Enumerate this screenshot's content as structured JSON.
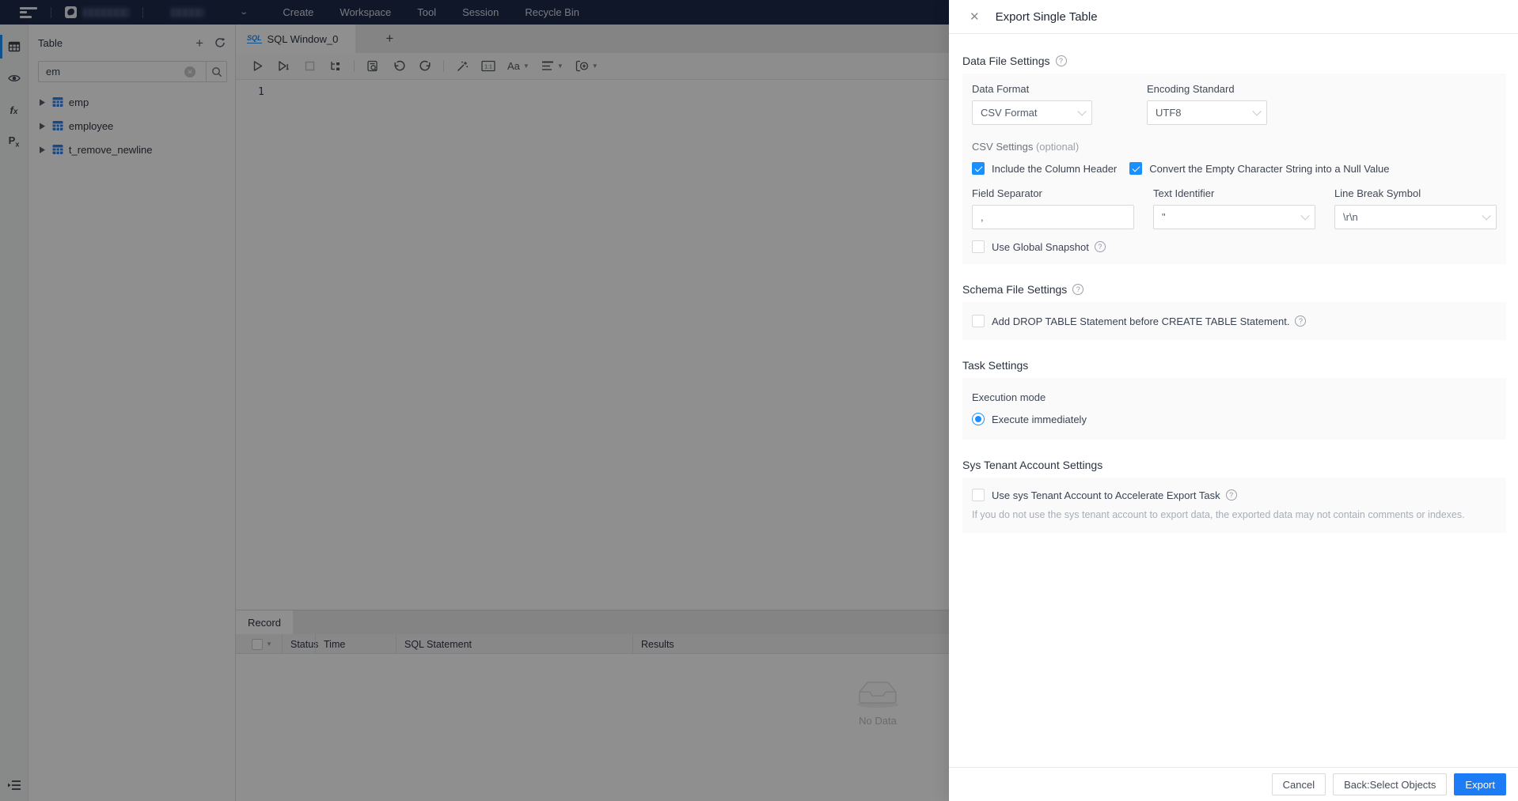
{
  "topbar": {
    "menu": [
      "Create",
      "Workspace",
      "Tool",
      "Session",
      "Recycle Bin"
    ]
  },
  "sidebar": {
    "title": "Table",
    "search_value": "em",
    "tree": [
      {
        "label": "emp"
      },
      {
        "label": "employee"
      },
      {
        "label": "t_remove_newline"
      }
    ]
  },
  "workbench": {
    "tab_badge": "SQL",
    "tab_label": "SQL Window_0",
    "new_tab": "+",
    "editor_line_number": "1",
    "toolbar": {
      "aa_label": "Aa",
      "ratio_label": "1:1"
    }
  },
  "record": {
    "tab": "Record",
    "columns": [
      "Status",
      "Time",
      "SQL Statement",
      "Results"
    ],
    "empty_text": "No Data"
  },
  "drawer": {
    "title": "Export Single Table",
    "data_file": {
      "heading": "Data File Settings",
      "data_format_label": "Data Format",
      "data_format_value": "CSV Format",
      "encoding_label": "Encoding Standard",
      "encoding_value": "UTF8",
      "csv_heading": "CSV Settings",
      "csv_optional": "(optional)",
      "cb_include_header": "Include the Column Header",
      "cb_empty_to_null": "Convert the Empty Character String into a Null Value",
      "field_separator_label": "Field Separator",
      "field_separator_value": ",",
      "text_identifier_label": "Text Identifier",
      "text_identifier_value": "\"",
      "line_break_label": "Line Break Symbol",
      "line_break_value": "\\r\\n",
      "cb_global_snapshot": "Use Global Snapshot"
    },
    "schema": {
      "heading": "Schema File Settings",
      "cb_drop_table": "Add DROP TABLE Statement before CREATE TABLE Statement."
    },
    "task": {
      "heading": "Task Settings",
      "execution_mode_label": "Execution mode",
      "radio_execute_immediately": "Execute immediately"
    },
    "sys_tenant": {
      "heading": "Sys Tenant Account Settings",
      "cb_use_sys": "Use sys Tenant Account to Accelerate Export Task",
      "note": "If you do not use the sys tenant account to export data, the exported data may not contain comments or indexes."
    },
    "footer": {
      "cancel": "Cancel",
      "back": "Back:Select Objects",
      "export": "Export"
    }
  },
  "colors": {
    "accent_blue": "#1890ff",
    "export_button": "#1b7cf6",
    "topbar_bg": "#1c2a4a",
    "panel_bg": "#fafafa",
    "mask": "rgba(0,0,0,0.44)"
  }
}
